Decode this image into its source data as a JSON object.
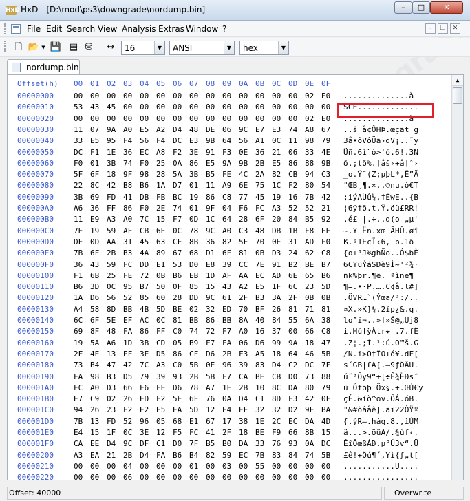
{
  "window": {
    "app_icon_text": "HxD",
    "title": "HxD - [D:\\mod\\ps3\\downgrade\\nordump.bin]",
    "minimize": "–",
    "maximize": "□",
    "close": "✕"
  },
  "menu": {
    "items": [
      "File",
      "Edit",
      "Search",
      "View",
      "Analysis",
      "Extras",
      "Window",
      "?"
    ],
    "mdi_min": "–",
    "mdi_restore": "❐",
    "mdi_close": "✕"
  },
  "toolbar": {
    "icons": [
      "new-file-icon",
      "open-folder-icon",
      "save-icon",
      "ram-icon",
      "disk-icon",
      "columns-icon"
    ],
    "bytes_per_row": "16",
    "charset": "ANSI",
    "display_mode": "hex"
  },
  "tab": {
    "label": "nordump.bin"
  },
  "header": {
    "offset_label": "Offset(h)",
    "columns": [
      "00",
      "01",
      "02",
      "03",
      "04",
      "05",
      "06",
      "07",
      "08",
      "09",
      "0A",
      "0B",
      "0C",
      "0D",
      "0E",
      "0F"
    ]
  },
  "rows": [
    {
      "offset": "00000000",
      "bytes": [
        "00",
        "00",
        "00",
        "00",
        "00",
        "00",
        "00",
        "00",
        "00",
        "00",
        "00",
        "00",
        "00",
        "00",
        "02",
        "E0"
      ],
      "ascii": "..............à"
    },
    {
      "offset": "00000010",
      "bytes": [
        "53",
        "43",
        "45",
        "00",
        "00",
        "00",
        "00",
        "00",
        "00",
        "00",
        "00",
        "00",
        "00",
        "00",
        "00",
        "00"
      ],
      "ascii": "SCE............."
    },
    {
      "offset": "00000020",
      "bytes": [
        "00",
        "00",
        "00",
        "00",
        "00",
        "00",
        "00",
        "00",
        "00",
        "00",
        "00",
        "00",
        "00",
        "00",
        "02",
        "E0"
      ],
      "ascii": "..............à"
    },
    {
      "offset": "00000030",
      "bytes": [
        "11",
        "07",
        "9A",
        "A0",
        "E5",
        "A2",
        "D4",
        "48",
        "DE",
        "06",
        "9C",
        "E7",
        "E3",
        "74",
        "A8",
        "67"
      ],
      "ascii": "..š å¢ÔHÞ.œçãt¨g"
    },
    {
      "offset": "00000040",
      "bytes": [
        "33",
        "E5",
        "95",
        "F4",
        "56",
        "F4",
        "DC",
        "E3",
        "9B",
        "64",
        "56",
        "A1",
        "0C",
        "11",
        "98",
        "79"
      ],
      "ascii": "3å•ôVôÜã›dV¡..˜y"
    },
    {
      "offset": "00000050",
      "bytes": [
        "DC",
        "F1",
        "1E",
        "36",
        "EC",
        "A8",
        "F2",
        "3E",
        "91",
        "F3",
        "0E",
        "36",
        "21",
        "06",
        "33",
        "4E"
      ],
      "ascii": "Üñ.6ì¨ò>'ó.6!.3N"
    },
    {
      "offset": "00000060",
      "bytes": [
        "F0",
        "01",
        "3B",
        "74",
        "F0",
        "25",
        "0A",
        "86",
        "E5",
        "9A",
        "9B",
        "2B",
        "E5",
        "86",
        "88",
        "9B"
      ],
      "ascii": "ð.;tð%.†åš›+å†ˆ›"
    },
    {
      "offset": "00000070",
      "bytes": [
        "5F",
        "6F",
        "18",
        "9F",
        "98",
        "28",
        "5A",
        "3B",
        "B5",
        "FE",
        "4C",
        "2A",
        "82",
        "CB",
        "94",
        "C3"
      ],
      "ascii": "_o.Ÿ˜(Z;µþL*‚Ë”Ã"
    },
    {
      "offset": "00000080",
      "bytes": [
        "22",
        "8C",
        "42",
        "B8",
        "B6",
        "1A",
        "D7",
        "01",
        "11",
        "A9",
        "6E",
        "75",
        "1C",
        "F2",
        "80",
        "54"
      ],
      "ascii": "\"ŒB¸¶.×..©nu.ò€T"
    },
    {
      "offset": "00000090",
      "bytes": [
        "3B",
        "69",
        "FD",
        "41",
        "DB",
        "FB",
        "BC",
        "19",
        "86",
        "C8",
        "77",
        "45",
        "19",
        "16",
        "7B",
        "42"
      ],
      "ascii": ";iýAÛû¼.†ÈwE..{B"
    },
    {
      "offset": "000000A0",
      "bytes": [
        "A6",
        "36",
        "FF",
        "86",
        "F0",
        "2E",
        "74",
        "01",
        "9F",
        "04",
        "F6",
        "FC",
        "A3",
        "52",
        "52",
        "21"
      ],
      "ascii": "¦6ÿ†ð.t.Ÿ.öü£RR!"
    },
    {
      "offset": "000000B0",
      "bytes": [
        "11",
        "E9",
        "A3",
        "A0",
        "7C",
        "15",
        "F7",
        "0D",
        "1C",
        "64",
        "28",
        "6F",
        "20",
        "84",
        "B5",
        "92"
      ],
      "ascii": ".é£ |.÷..d(o „µ'"
    },
    {
      "offset": "000000C0",
      "bytes": [
        "7E",
        "19",
        "59",
        "AF",
        "CB",
        "6E",
        "0C",
        "78",
        "9C",
        "A0",
        "C3",
        "48",
        "DB",
        "1B",
        "F8",
        "EE"
      ],
      "ascii": "~.Y¯Ën.xœ ÃHÛ.øî"
    },
    {
      "offset": "000000D0",
      "bytes": [
        "DF",
        "0D",
        "AA",
        "31",
        "45",
        "63",
        "CF",
        "8B",
        "36",
        "82",
        "5F",
        "70",
        "0E",
        "31",
        "AD",
        "F0"
      ],
      "ascii": "ß.ª1EcÏ‹6‚_p.1­ð"
    },
    {
      "offset": "000000E0",
      "bytes": [
        "7B",
        "6F",
        "2B",
        "B3",
        "4A",
        "89",
        "67",
        "68",
        "D1",
        "6F",
        "81",
        "0B",
        "D3",
        "24",
        "62",
        "C8"
      ],
      "ascii": "{o+³J‰ghÑo..Ó$bÈ"
    },
    {
      "offset": "000000F0",
      "bytes": [
        "36",
        "43",
        "59",
        "FC",
        "DD",
        "E1",
        "53",
        "D0",
        "E8",
        "39",
        "CC",
        "7E",
        "91",
        "B2",
        "BE",
        "B7"
      ],
      "ascii": "6CYüÝáSÐè9Ì~'²¾·"
    },
    {
      "offset": "00000100",
      "bytes": [
        "F1",
        "6B",
        "25",
        "FE",
        "72",
        "0B",
        "B6",
        "EB",
        "1D",
        "AF",
        "AA",
        "EC",
        "AD",
        "6E",
        "65",
        "B6"
      ],
      "ascii": "ñk%þr.¶ë.¯ªì­ne¶"
    },
    {
      "offset": "00000110",
      "bytes": [
        "B6",
        "3D",
        "0C",
        "95",
        "B7",
        "50",
        "0F",
        "85",
        "15",
        "43",
        "A2",
        "E5",
        "1F",
        "6C",
        "23",
        "5D"
      ],
      "ascii": "¶=.•·P.….C¢å.l#]"
    },
    {
      "offset": "00000120",
      "bytes": [
        "1A",
        "D6",
        "56",
        "52",
        "85",
        "60",
        "28",
        "DD",
        "9C",
        "61",
        "2F",
        "B3",
        "3A",
        "2F",
        "0B",
        "0B"
      ],
      "ascii": ".ÖVR…`(Ýœa/³:/.."
    },
    {
      "offset": "00000130",
      "bytes": [
        "A4",
        "58",
        "8D",
        "BB",
        "4B",
        "5D",
        "BE",
        "02",
        "32",
        "ED",
        "70",
        "BF",
        "26",
        "81",
        "71",
        "81"
      ],
      "ascii": "¤X.»K]¾.2íp¿&.q."
    },
    {
      "offset": "00000140",
      "bytes": [
        "6C",
        "6F",
        "5E",
        "EF",
        "AC",
        "0C",
        "81",
        "BB",
        "86",
        "BB",
        "8A",
        "40",
        "84",
        "55",
        "6A",
        "38"
      ],
      "ascii": "lo^ï¬..»†»Š@„Uj8"
    },
    {
      "offset": "00000150",
      "bytes": [
        "69",
        "8F",
        "48",
        "FA",
        "86",
        "FF",
        "C0",
        "74",
        "72",
        "F7",
        "A0",
        "16",
        "37",
        "00",
        "66",
        "C8"
      ],
      "ascii": "i.Hú†ÿÀtr÷ .7.fÈ"
    },
    {
      "offset": "00000160",
      "bytes": [
        "19",
        "5A",
        "A6",
        "1D",
        "3B",
        "CD",
        "05",
        "B9",
        "F7",
        "FA",
        "06",
        "D6",
        "99",
        "9A",
        "18",
        "47"
      ],
      "ascii": ".Z¦.;Í.¹÷ú.Ö™š.G"
    },
    {
      "offset": "00000170",
      "bytes": [
        "2F",
        "4E",
        "13",
        "EF",
        "3E",
        "D5",
        "86",
        "CF",
        "D6",
        "2B",
        "F3",
        "A5",
        "18",
        "64",
        "46",
        "5B"
      ],
      "ascii": "/N.ï>Õ†ÏÖ+ó¥.dF["
    },
    {
      "offset": "00000180",
      "bytes": [
        "73",
        "B4",
        "47",
        "42",
        "7C",
        "A3",
        "C0",
        "5B",
        "0E",
        "96",
        "39",
        "83",
        "D4",
        "C2",
        "DC",
        "7F"
      ],
      "ascii": "s´GB|£À[.–9ƒÔÂÜ."
    },
    {
      "offset": "00000190",
      "bytes": [
        "FA",
        "98",
        "B3",
        "D5",
        "79",
        "39",
        "93",
        "2B",
        "5B",
        "F7",
        "CA",
        "BE",
        "CB",
        "D0",
        "73",
        "88"
      ],
      "ascii": "ú˜³Õy9“+[÷Ê¾ËÐsˆ"
    },
    {
      "offset": "000001A0",
      "bytes": [
        "FC",
        "A0",
        "D3",
        "66",
        "F6",
        "FE",
        "D6",
        "78",
        "A7",
        "1E",
        "2B",
        "10",
        "8C",
        "DA",
        "80",
        "79"
      ],
      "ascii": "ü Óföþ Öx§.+.ŒÚ€y"
    },
    {
      "offset": "000001B0",
      "bytes": [
        "E7",
        "C9",
        "02",
        "26",
        "ED",
        "F2",
        "5E",
        "6F",
        "76",
        "0A",
        "D4",
        "C1",
        "8D",
        "F3",
        "42",
        "0F"
      ],
      "ascii": "çÉ.&íò^ov.ÔÁ.óB."
    },
    {
      "offset": "000001C0",
      "bytes": [
        "94",
        "26",
        "23",
        "F2",
        "E2",
        "E5",
        "EA",
        "5D",
        "12",
        "E4",
        "EF",
        "32",
        "32",
        "D2",
        "9F",
        "BA"
      ],
      "ascii": "\"&#òâåê].äï22ÒŸº"
    },
    {
      "offset": "000001D0",
      "bytes": [
        "7B",
        "13",
        "FD",
        "52",
        "96",
        "05",
        "68",
        "E1",
        "67",
        "17",
        "38",
        "1E",
        "2C",
        "EC",
        "DA",
        "4D"
      ],
      "ascii": "{.ýR–.hág.8.,ìÚM"
    },
    {
      "offset": "000001E0",
      "bytes": [
        "E4",
        "15",
        "1F",
        "0C",
        "3E",
        "12",
        "F5",
        "FC",
        "41",
        "2F",
        "18",
        "BE",
        "F9",
        "66",
        "8B",
        "15"
      ],
      "ascii": "ä...>.õüA/.¾ùf‹."
    },
    {
      "offset": "000001F0",
      "bytes": [
        "CA",
        "EE",
        "D4",
        "9C",
        "DF",
        "C1",
        "D0",
        "7F",
        "B5",
        "B0",
        "DA",
        "33",
        "76",
        "93",
        "0A",
        "DC"
      ],
      "ascii": "ÊîÔœßÁÐ.µ°Ú3v“.Ü"
    },
    {
      "offset": "00000200",
      "bytes": [
        "A3",
        "EA",
        "21",
        "2B",
        "D4",
        "FA",
        "B6",
        "B4",
        "82",
        "59",
        "EC",
        "7B",
        "83",
        "84",
        "74",
        "5B"
      ],
      "ascii": "£ê!+Ôú¶´‚Yì{ƒ„t["
    },
    {
      "offset": "00000210",
      "bytes": [
        "00",
        "00",
        "00",
        "04",
        "00",
        "00",
        "00",
        "01",
        "00",
        "03",
        "00",
        "55",
        "00",
        "00",
        "00",
        "00"
      ],
      "ascii": "...........U...."
    },
    {
      "offset": "00000220",
      "bytes": [
        "00",
        "00",
        "00",
        "06",
        "00",
        "00",
        "00",
        "00",
        "00",
        "00",
        "00",
        "00",
        "00",
        "00",
        "00",
        "00"
      ],
      "ascii": "................"
    }
  ],
  "status": {
    "offset": "Offset: 40000",
    "mode": "Overwrite"
  },
  "colors": {
    "offset_blue": "#3a5bd1",
    "highlight_red": "#e0202a"
  }
}
